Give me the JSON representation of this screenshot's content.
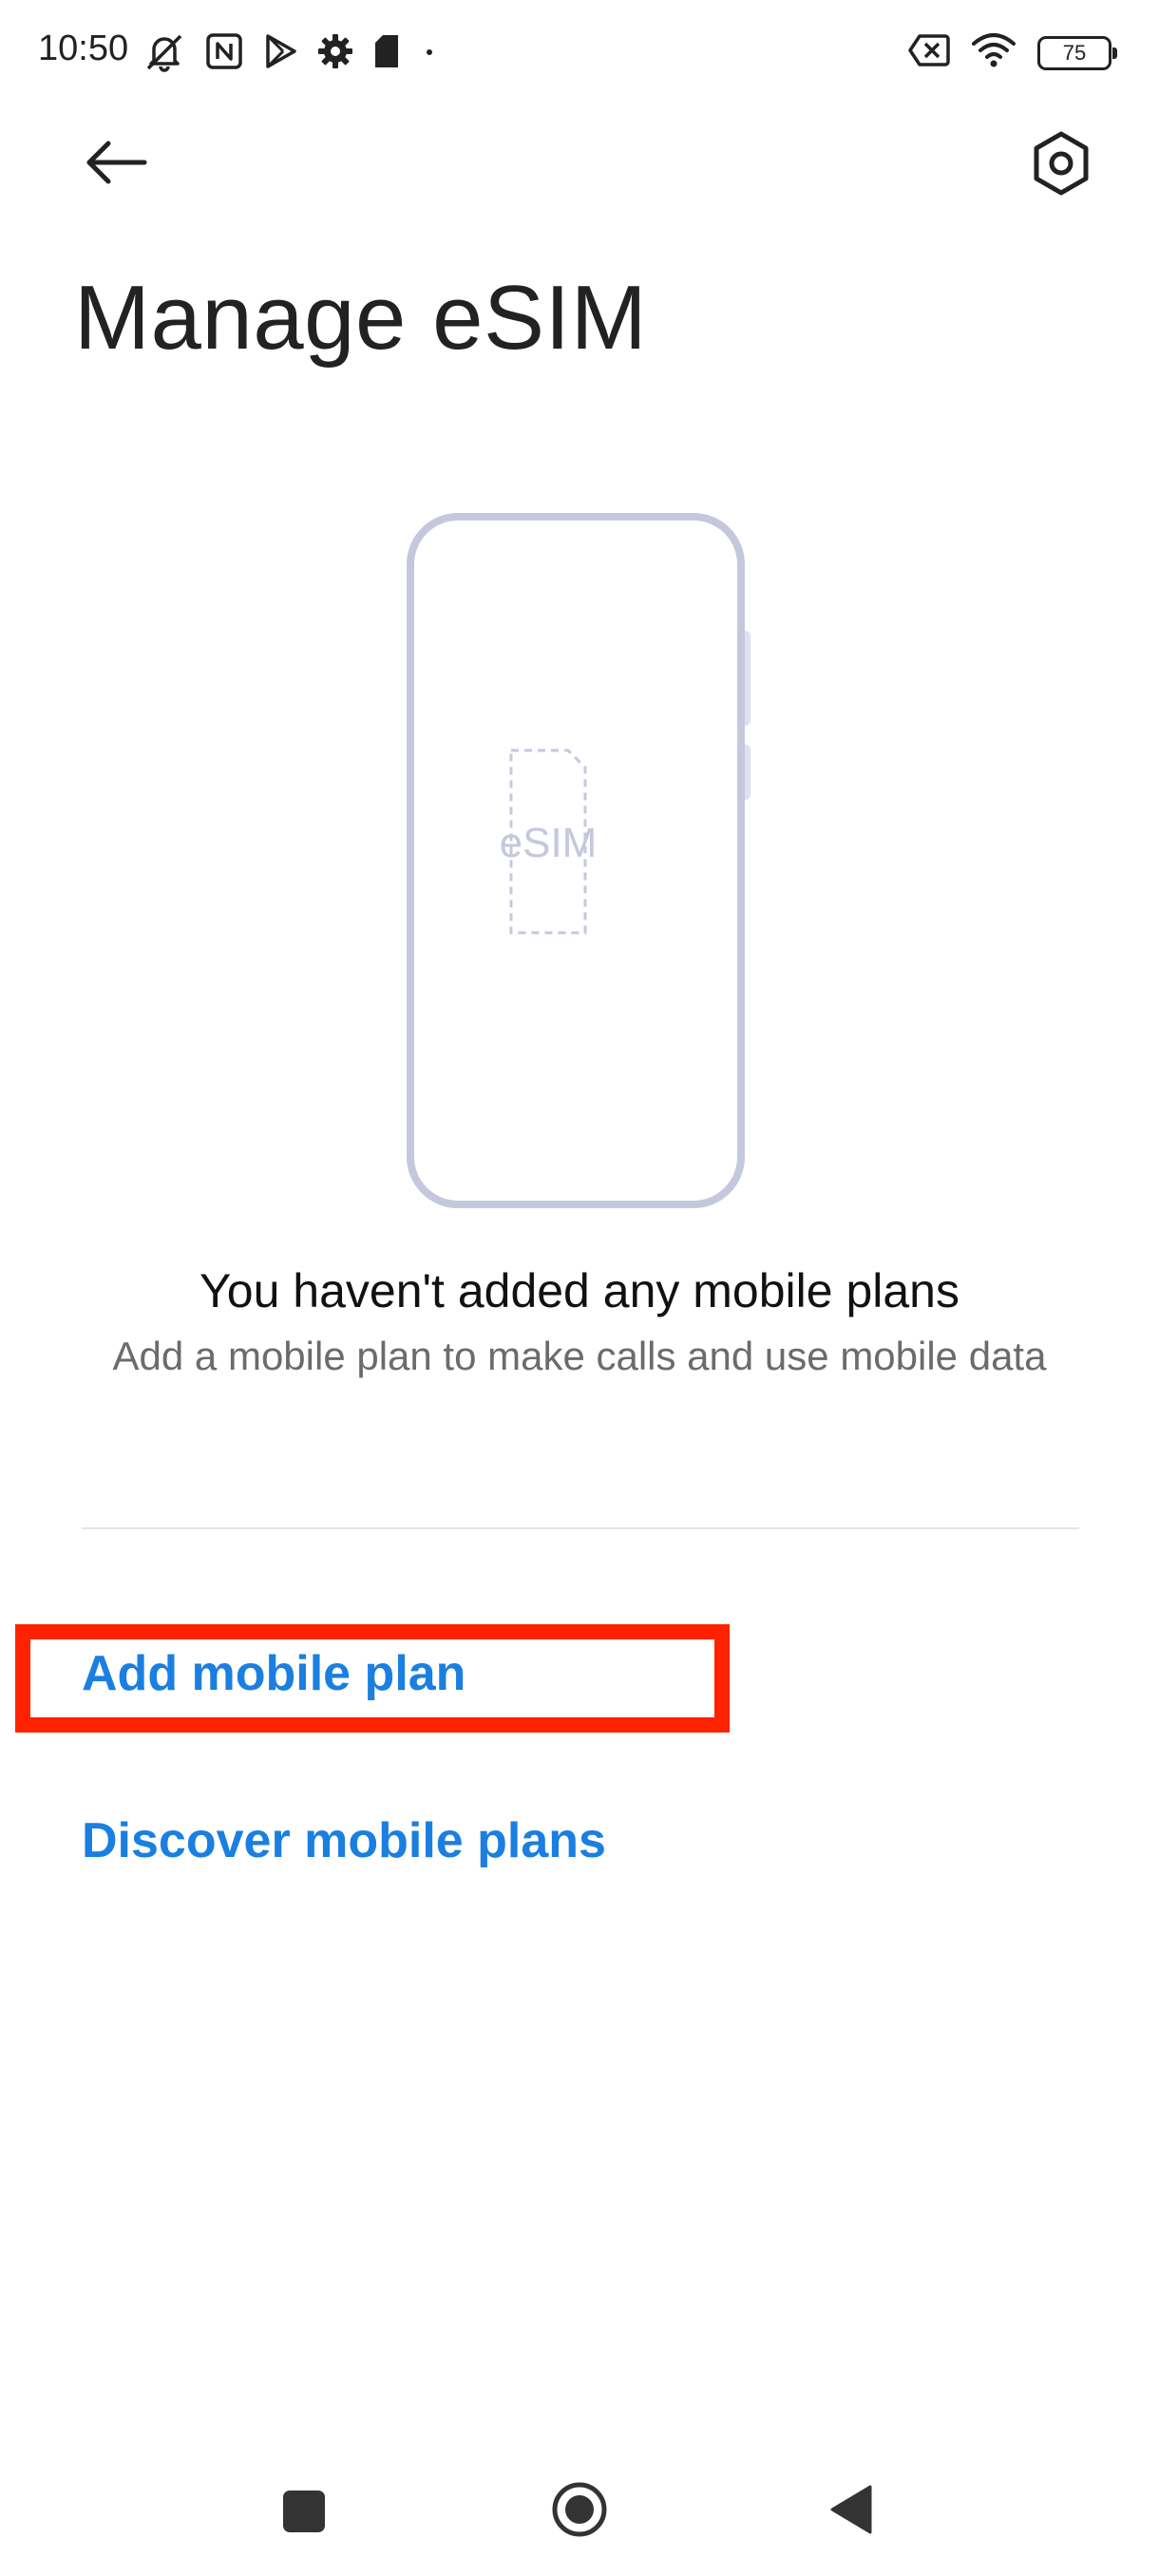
{
  "status_bar": {
    "time": "10:50",
    "battery": "75",
    "left_icons": [
      "bell-muted-icon",
      "nfc-icon",
      "play-store-icon",
      "gear-icon",
      "sim-icon",
      "dot-icon"
    ],
    "right_icons": [
      "no-sim-icon",
      "wifi-icon",
      "battery-icon"
    ]
  },
  "header": {
    "back_icon": "arrow-left-icon",
    "settings_icon": "hexagon-settings-icon",
    "title": "Manage eSIM"
  },
  "illustration": {
    "chip_label": "eSIM",
    "phone_color": "#c5c8dd",
    "chip_color": "#c5c8dd"
  },
  "empty_state": {
    "title": "You haven't added any mobile plans",
    "subtitle": "Add a mobile plan to make calls and use mobile data"
  },
  "actions": {
    "add_plan": "Add mobile plan",
    "discover_plans": "Discover mobile plans"
  },
  "colors": {
    "link": "#1a7fe0",
    "highlight": "#ff2200"
  },
  "nav_bar": {
    "icons": [
      "recents-square-icon",
      "home-circle-icon",
      "back-triangle-icon"
    ]
  }
}
